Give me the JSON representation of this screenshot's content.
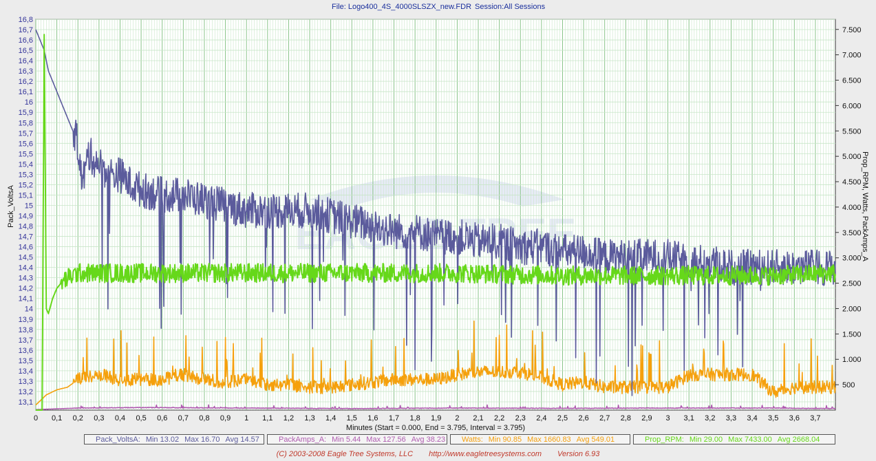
{
  "header": {
    "file_label": "File: Logo400_4S_4000SLSZX_new.FDR",
    "session_label": "Session:All Sessions"
  },
  "footer": {
    "copyright": "(C) 2003-2008 Eagle Tree Systems, LLC",
    "url": "http://www.eagletreesystems.com",
    "version": "Version 6.93"
  },
  "legend": [
    {
      "name": "Pack_VoltsA:",
      "min": "Min 13.02",
      "max": "Max 16.70",
      "avg": "Avg 14.57",
      "color": "#5b5b9c"
    },
    {
      "name": "PackAmps_A:",
      "min": "Min 5.44",
      "max": "Max 127.56",
      "avg": "Avg 38.23",
      "color": "#b05cb0"
    },
    {
      "name": "Watts:",
      "min": "Min 90.85",
      "max": "Max 1660.83",
      "avg": "Avg 549.01",
      "color": "#f5a00c"
    },
    {
      "name": "Prop_RPM:",
      "min": "Min 29.00",
      "max": "Max 7433.00",
      "avg": "Avg 2668.04",
      "color": "#66d81a"
    }
  ],
  "chart_data": {
    "type": "line",
    "xlabel": "Minutes (Start = 0.000,  End = 3.795,  Interval =  3.795)",
    "ylabel_left": "Pack_VoltsA",
    "ylabel_right": "Prop_RPM, Watts, PackAmps_A",
    "xlim": [
      0,
      3.795
    ],
    "ylim_left": [
      13.02,
      16.8
    ],
    "ylim_right": [
      0,
      7700
    ],
    "x_ticks": [
      "0",
      "0,1",
      "0,2",
      "0,3",
      "0,4",
      "0,5",
      "0,6",
      "0,7",
      "0,8",
      "0,9",
      "1",
      "1,1",
      "1,2",
      "1,3",
      "1,4",
      "1,5",
      "1,6",
      "1,7",
      "1,8",
      "1,9",
      "2",
      "2,1",
      "2,2",
      "2,3",
      "2,4",
      "2,5",
      "2,6",
      "2,7",
      "2,8",
      "2,9",
      "3",
      "3,1",
      "3,2",
      "3,3",
      "3,4",
      "3,5",
      "3,6",
      "3,7"
    ],
    "y_ticks_left": [
      "16,8",
      "16,7",
      "16,6",
      "16,5",
      "16,4",
      "16,3",
      "16,2",
      "16,1",
      "16",
      "15,9",
      "15,8",
      "15,7",
      "15,6",
      "15,5",
      "15,4",
      "15,3",
      "15,2",
      "15,1",
      "15",
      "14,9",
      "14,8",
      "14,7",
      "14,6",
      "14,5",
      "14,4",
      "14,3",
      "14,2",
      "14,1",
      "14",
      "13,9",
      "13,8",
      "13,7",
      "13,6",
      "13,5",
      "13,4",
      "13,3",
      "13,2",
      "13,1"
    ],
    "y_ticks_right": [
      "7.500",
      "7.000",
      "6.500",
      "6.000",
      "5.500",
      "5.000",
      "4.500",
      "4.000",
      "3.500",
      "3.000",
      "2.500",
      "2.000",
      "1.500",
      "1.000",
      "500"
    ],
    "grid": true,
    "watermark": "EAGLE TREE",
    "series": [
      {
        "name": "Pack_VoltsA",
        "axis": "left",
        "color": "#5b5b9c",
        "x": [
          0,
          0.02,
          0.04,
          0.06,
          0.08,
          0.1,
          0.15,
          0.2,
          0.22,
          0.25,
          0.3,
          0.35,
          0.4,
          0.45,
          0.5,
          0.6,
          0.7,
          0.8,
          0.9,
          1.0,
          1.1,
          1.2,
          1.3,
          1.4,
          1.5,
          1.6,
          1.7,
          1.8,
          1.9,
          2.0,
          2.1,
          2.2,
          2.3,
          2.4,
          2.5,
          2.6,
          2.7,
          2.8,
          2.9,
          3.0,
          3.1,
          3.2,
          3.3,
          3.4,
          3.5
        ],
        "values": [
          16.7,
          16.6,
          16.5,
          16.3,
          16.2,
          16.1,
          15.85,
          15.6,
          15.2,
          15.5,
          15.4,
          15.3,
          15.3,
          15.2,
          15.15,
          15.1,
          15.1,
          15.05,
          15.0,
          14.95,
          14.95,
          14.95,
          14.95,
          14.9,
          14.85,
          14.8,
          14.75,
          14.75,
          14.7,
          14.7,
          14.65,
          14.65,
          14.6,
          14.6,
          14.55,
          14.55,
          14.5,
          14.5,
          14.5,
          14.5,
          14.45,
          14.45,
          14.4,
          14.4,
          14.4
        ]
      },
      {
        "name": "PackAmps_A",
        "axis": "right",
        "color": "#b05cb0",
        "x": [
          0,
          0.2,
          0.5,
          1,
          1.5,
          2,
          2.5,
          3,
          3.5,
          3.795
        ],
        "values": [
          10,
          40,
          50,
          40,
          30,
          40,
          35,
          40,
          40,
          30
        ]
      },
      {
        "name": "Watts",
        "axis": "right",
        "color": "#f5a00c",
        "x": [
          0,
          0.05,
          0.1,
          0.15,
          0.2,
          0.3,
          0.4,
          0.5,
          0.6,
          0.7,
          0.8,
          0.9,
          1.0,
          1.1,
          1.2,
          1.3,
          1.4,
          1.5,
          1.6,
          1.7,
          1.8,
          1.9,
          2.0,
          2.1,
          2.2,
          2.3,
          2.4,
          2.5,
          2.6,
          2.7,
          2.8,
          2.9,
          3.0,
          3.1,
          3.2,
          3.3,
          3.4,
          3.5,
          3.6,
          3.7,
          3.795
        ],
        "values": [
          100,
          300,
          400,
          450,
          600,
          700,
          600,
          600,
          600,
          700,
          600,
          550,
          600,
          500,
          500,
          450,
          450,
          500,
          550,
          600,
          600,
          600,
          700,
          750,
          750,
          750,
          650,
          500,
          550,
          450,
          450,
          450,
          450,
          700,
          700,
          700,
          700,
          350,
          450,
          450,
          450
        ]
      },
      {
        "name": "Prop_RPM",
        "axis": "right",
        "color": "#66d81a",
        "x": [
          0,
          0.03,
          0.04,
          0.05,
          0.06,
          0.08,
          0.1,
          0.12,
          0.15,
          0.2,
          0.5,
          1,
          1.5,
          2,
          2.5,
          3,
          3.5,
          3.795
        ],
        "values": [
          0,
          0,
          7400,
          2000,
          1900,
          2200,
          2400,
          2500,
          2600,
          2700,
          2700,
          2700,
          2700,
          2700,
          2650,
          2650,
          2650,
          2700
        ]
      }
    ]
  }
}
